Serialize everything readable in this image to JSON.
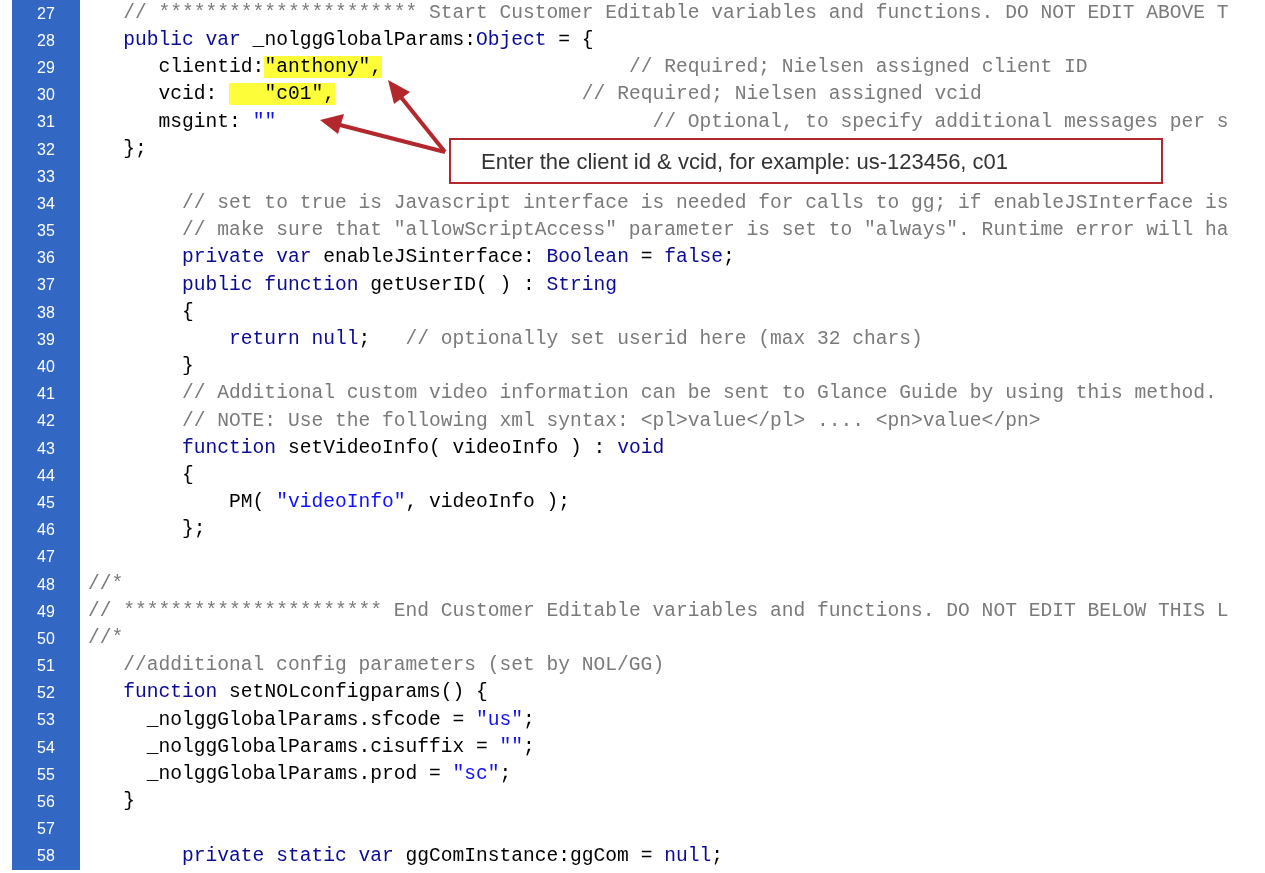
{
  "lines": [
    {
      "number": "27",
      "tokens": [
        {
          "kind": "comment",
          "text": "   // ********************** Start Customer Editable variables and functions. DO NOT EDIT ABOVE T"
        }
      ]
    },
    {
      "number": "28",
      "tokens": [
        {
          "kind": "keyword",
          "text": "   public var"
        },
        {
          "kind": "plain",
          "text": " _nolggGlobalParams:"
        },
        {
          "kind": "keyword",
          "text": "Object"
        },
        {
          "kind": "plain",
          "text": " = {"
        }
      ]
    },
    {
      "number": "29",
      "tokens": [
        {
          "kind": "plain",
          "text": "      clientid:"
        },
        {
          "kind": "highlight",
          "text": "\"anthony\","
        },
        {
          "kind": "comment",
          "text": "                     // Required; Nielsen assigned client ID"
        }
      ]
    },
    {
      "number": "30",
      "tokens": [
        {
          "kind": "plain",
          "text": "      vcid: "
        },
        {
          "kind": "highlight",
          "text": "   \"c01\","
        },
        {
          "kind": "comment",
          "text": "                     // Required; Nielsen assigned vcid"
        }
      ]
    },
    {
      "number": "31",
      "tokens": [
        {
          "kind": "plain",
          "text": "      msgint: "
        },
        {
          "kind": "string",
          "text": "\"\""
        },
        {
          "kind": "comment",
          "text": "                                // Optional, to specify additional messages per s"
        }
      ]
    },
    {
      "number": "32",
      "tokens": [
        {
          "kind": "plain",
          "text": "   };"
        }
      ]
    },
    {
      "number": "33"
    },
    {
      "number": "34",
      "tokens": [
        {
          "kind": "comment",
          "text": "        // set to true is Javascript interface is needed for calls to gg; if enableJSInterface is"
        }
      ]
    },
    {
      "number": "35",
      "tokens": [
        {
          "kind": "comment",
          "text": "        // make sure that \"allowScriptAccess\" parameter is set to \"always\". Runtime error will ha"
        }
      ]
    },
    {
      "number": "36",
      "tokens": [
        {
          "kind": "keyword",
          "text": "        private var"
        },
        {
          "kind": "plain",
          "text": " enableJSinterface: "
        },
        {
          "kind": "keyword",
          "text": "Boolean"
        },
        {
          "kind": "plain",
          "text": " = "
        },
        {
          "kind": "keyword",
          "text": "false"
        },
        {
          "kind": "plain",
          "text": ";"
        }
      ]
    },
    {
      "number": "37",
      "tokens": [
        {
          "kind": "keyword",
          "text": "        public function"
        },
        {
          "kind": "plain",
          "text": " getUserID( ) : "
        },
        {
          "kind": "keyword",
          "text": "String"
        }
      ]
    },
    {
      "number": "38",
      "tokens": [
        {
          "kind": "plain",
          "text": "        {"
        }
      ]
    },
    {
      "number": "39",
      "tokens": [
        {
          "kind": "keyword",
          "text": "            return null"
        },
        {
          "kind": "plain",
          "text": ";   "
        },
        {
          "kind": "comment",
          "text": "// optionally set userid here (max 32 chars)"
        }
      ]
    },
    {
      "number": "40",
      "tokens": [
        {
          "kind": "plain",
          "text": "        }"
        }
      ]
    },
    {
      "number": "41",
      "tokens": [
        {
          "kind": "comment",
          "text": "        // Additional custom video information can be sent to Glance Guide by using this method."
        }
      ]
    },
    {
      "number": "42",
      "tokens": [
        {
          "kind": "comment",
          "text": "        // NOTE: Use the following xml syntax: <pl>value</pl> .... <pn>value</pn>"
        }
      ]
    },
    {
      "number": "43",
      "tokens": [
        {
          "kind": "keyword",
          "text": "        function"
        },
        {
          "kind": "plain",
          "text": " setVideoInfo( videoInfo ) : "
        },
        {
          "kind": "keyword",
          "text": "void"
        }
      ]
    },
    {
      "number": "44",
      "tokens": [
        {
          "kind": "plain",
          "text": "        {"
        }
      ]
    },
    {
      "number": "45",
      "tokens": [
        {
          "kind": "plain",
          "text": "            PM( "
        },
        {
          "kind": "string",
          "text": "\"videoInfo\""
        },
        {
          "kind": "plain",
          "text": ", videoInfo );"
        }
      ]
    },
    {
      "number": "46",
      "tokens": [
        {
          "kind": "plain",
          "text": "        };"
        }
      ]
    },
    {
      "number": "47"
    },
    {
      "number": "48",
      "tokens": [
        {
          "kind": "comment",
          "text": "//*"
        }
      ]
    },
    {
      "number": "49",
      "tokens": [
        {
          "kind": "comment",
          "text": "// ********************** End Customer Editable variables and functions. DO NOT EDIT BELOW THIS L"
        }
      ]
    },
    {
      "number": "50",
      "tokens": [
        {
          "kind": "comment",
          "text": "//*"
        }
      ]
    },
    {
      "number": "51",
      "tokens": [
        {
          "kind": "comment",
          "text": "   //additional config parameters (set by NOL/GG)"
        }
      ]
    },
    {
      "number": "52",
      "tokens": [
        {
          "kind": "keyword",
          "text": "   function"
        },
        {
          "kind": "plain",
          "text": " setNOLconfigparams() {"
        }
      ]
    },
    {
      "number": "53",
      "tokens": [
        {
          "kind": "plain",
          "text": "     _nolggGlobalParams.sfcode = "
        },
        {
          "kind": "string",
          "text": "\"us\""
        },
        {
          "kind": "plain",
          "text": ";"
        }
      ]
    },
    {
      "number": "54",
      "tokens": [
        {
          "kind": "plain",
          "text": "     _nolggGlobalParams.cisuffix = "
        },
        {
          "kind": "string",
          "text": "\"\""
        },
        {
          "kind": "plain",
          "text": ";"
        }
      ]
    },
    {
      "number": "55",
      "tokens": [
        {
          "kind": "plain",
          "text": "     _nolggGlobalParams.prod = "
        },
        {
          "kind": "string",
          "text": "\"sc\""
        },
        {
          "kind": "plain",
          "text": ";"
        }
      ]
    },
    {
      "number": "56",
      "tokens": [
        {
          "kind": "plain",
          "text": "   }"
        }
      ]
    },
    {
      "number": "57"
    },
    {
      "number": "58",
      "tokens": [
        {
          "kind": "keyword",
          "text": "        private static var"
        },
        {
          "kind": "plain",
          "text": " ggComInstance:ggCom = "
        },
        {
          "kind": "keyword",
          "text": "null"
        },
        {
          "kind": "plain",
          "text": ";"
        }
      ]
    }
  ],
  "callout": {
    "text": "Enter the client id & vcid, for example: us-123456, c01"
  }
}
